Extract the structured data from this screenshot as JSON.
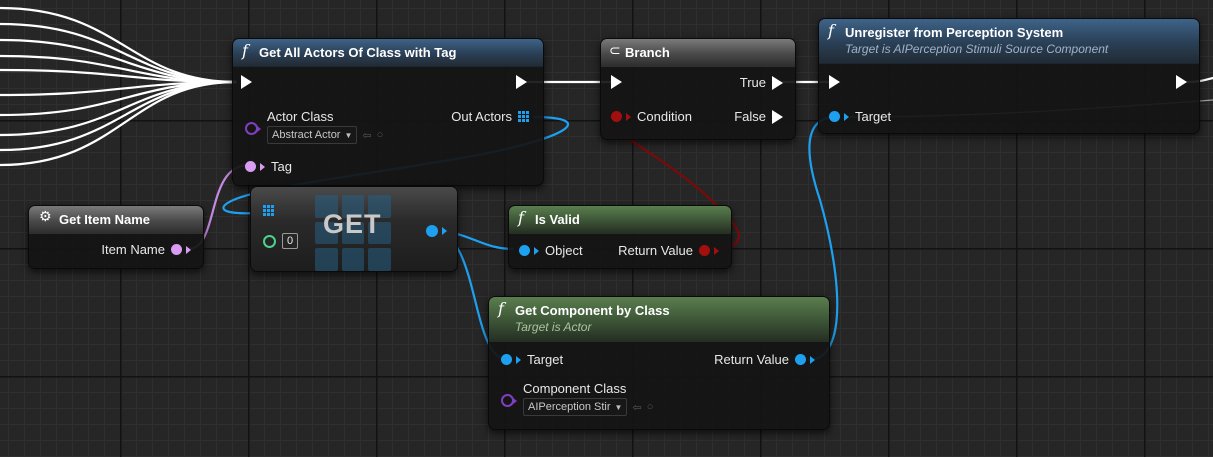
{
  "graph": {
    "nodes": {
      "get_all_actors": {
        "title": "Get All Actors Of Class with Tag",
        "pin_actor_class": "Actor Class",
        "actor_class_value": "Abstract Actor",
        "pin_tag": "Tag",
        "pin_out_actors": "Out Actors"
      },
      "branch": {
        "title": "Branch",
        "pin_condition": "Condition",
        "pin_true": "True",
        "pin_false": "False"
      },
      "unregister": {
        "title": "Unregister from Perception System",
        "subtitle": "Target is AIPerception Stimuli Source Component",
        "pin_target": "Target"
      },
      "get_item_name": {
        "title": "Get Item Name",
        "pin_item_name": "Item Name"
      },
      "get_array": {
        "label": "GET",
        "index_value": "0"
      },
      "is_valid": {
        "title": "Is Valid",
        "pin_object": "Object",
        "pin_return": "Return Value"
      },
      "get_component": {
        "title": "Get Component by Class",
        "subtitle": "Target is Actor",
        "pin_target": "Target",
        "pin_return": "Return Value",
        "pin_component_class": "Component Class",
        "component_class_value": "AIPerception Stir"
      }
    },
    "colors": {
      "exec": "#ffffff",
      "object_pin": "#1ea0f0",
      "bool_pin": "#a30f0f",
      "name_pin": "#d99cf2",
      "class_pin": "#7f3fbf",
      "int_pin": "#4bd28c"
    },
    "icons": {
      "function": "function-icon",
      "branch": "branch-icon",
      "getter": "gear-icon",
      "array": "array-grid-icon",
      "browse": "browse-arrow-icon",
      "search": "search-icon"
    }
  }
}
